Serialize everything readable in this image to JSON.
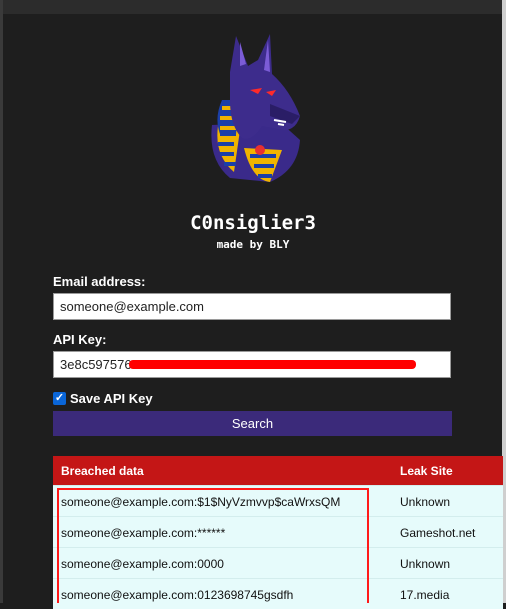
{
  "app": {
    "title": "C0nsiglier3",
    "subtitle": "made by BLY",
    "logo_icon": "anubis-jackal-head-logo"
  },
  "form": {
    "email_label": "Email address:",
    "email_value": "someone@example.com",
    "api_label": "API Key:",
    "api_value": "3e8c597576",
    "save_label": "Save API Key",
    "save_checked": true,
    "search_label": "Search"
  },
  "table": {
    "headers": [
      "Breached data",
      "Leak Site"
    ],
    "rows": [
      {
        "data": "someone@example.com:$1$NyVzmvvp$caWrxsQM",
        "site": "Unknown"
      },
      {
        "data": "someone@example.com:******",
        "site": "Gameshot.net"
      },
      {
        "data": "someone@example.com:0000",
        "site": "Unknown"
      },
      {
        "data": "someone@example.com:0123698745gsdfh",
        "site": "17.media"
      }
    ]
  },
  "colors": {
    "background": "#1e1e1e",
    "button": "#3b2a7a",
    "table_header": "#c41616",
    "row": "#e6fbfb",
    "highlight": "#ff1a1a"
  }
}
